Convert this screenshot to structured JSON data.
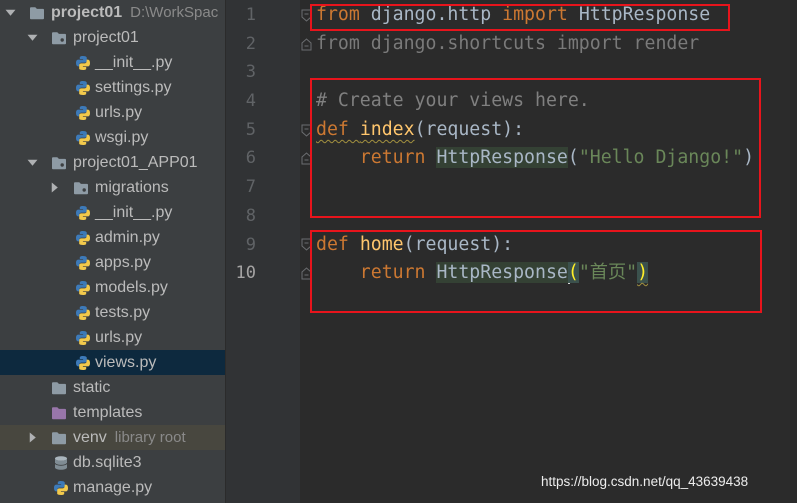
{
  "project_tree": {
    "items": [
      {
        "label": "project01",
        "hint": "D:\\WorkSpac",
        "icon": "folder-icon",
        "expanded": true
      },
      {
        "label": "project01",
        "icon": "package-folder-icon",
        "expanded": true
      },
      {
        "label": "__init__.py",
        "icon": "python-file-icon"
      },
      {
        "label": "settings.py",
        "icon": "python-file-icon"
      },
      {
        "label": "urls.py",
        "icon": "python-file-icon"
      },
      {
        "label": "wsgi.py",
        "icon": "python-file-icon"
      },
      {
        "label": "project01_APP01",
        "icon": "package-folder-icon",
        "expanded": true
      },
      {
        "label": "migrations",
        "icon": "package-folder-icon",
        "expanded": false
      },
      {
        "label": "__init__.py",
        "icon": "python-file-icon"
      },
      {
        "label": "admin.py",
        "icon": "python-file-icon"
      },
      {
        "label": "apps.py",
        "icon": "python-file-icon"
      },
      {
        "label": "models.py",
        "icon": "python-file-icon"
      },
      {
        "label": "tests.py",
        "icon": "python-file-icon"
      },
      {
        "label": "urls.py",
        "icon": "python-file-icon"
      },
      {
        "label": "views.py",
        "icon": "python-file-icon",
        "selected": true
      },
      {
        "label": "static",
        "icon": "folder-icon"
      },
      {
        "label": "templates",
        "icon": "templates-folder-icon"
      },
      {
        "label": "venv",
        "hint": "library root",
        "icon": "folder-icon",
        "expanded": false
      },
      {
        "label": "db.sqlite3",
        "icon": "database-file-icon"
      },
      {
        "label": "manage.py",
        "icon": "python-file-icon"
      }
    ]
  },
  "editor": {
    "line_numbers": [
      "1",
      "2",
      "3",
      "4",
      "5",
      "6",
      "7",
      "8",
      "9",
      "10"
    ],
    "lines": [
      [
        "from ",
        "django.http ",
        "import ",
        "HttpResponse"
      ],
      [
        "from django.shortcuts import render"
      ],
      [],
      [
        "# Create your views here."
      ],
      [
        "def ",
        "index",
        "(request):"
      ],
      [
        "return ",
        "HttpResponse",
        "(",
        "\"Hello Django!\"",
        ")"
      ],
      [],
      [],
      [
        "def ",
        "home",
        "(request):"
      ],
      [
        "return ",
        "HttpResponse",
        "(",
        "\"首页\"",
        ")"
      ]
    ]
  },
  "watermark": "https://blog.csdn.net/qq_43639438",
  "colors": {
    "keyword": "#cc7832",
    "function_name": "#ffc66d",
    "string": "#6a8759",
    "comment": "#808080",
    "default_text": "#a9b7c6",
    "unused_import": "#7a7a7a",
    "usage_highlight": "#344134",
    "brace_match_bg": "#3b514d",
    "brace_match_fg": "#ffef28",
    "annotation_box": "#e8141c",
    "selection": "#0d293e"
  }
}
